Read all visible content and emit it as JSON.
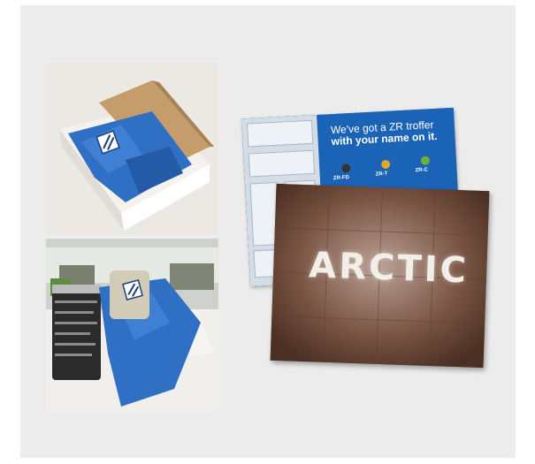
{
  "photos": {
    "box": {
      "icon": "logo-tile-icon"
    },
    "tumbler": {
      "icon": "logo-tile-icon"
    }
  },
  "cards": {
    "zr_troffer": {
      "headline_line1": "We've got a ZR troffer",
      "headline_line2": "with your name on it.",
      "product_labels": [
        "ZR-FD",
        "ZR-T",
        "ZR-C"
      ]
    },
    "arctic": {
      "word": "ARCTIC"
    }
  },
  "colors": {
    "background_panel": "#ececec",
    "tissue_blue": "#2f6fc4",
    "card_blue": "#1b63b6"
  }
}
